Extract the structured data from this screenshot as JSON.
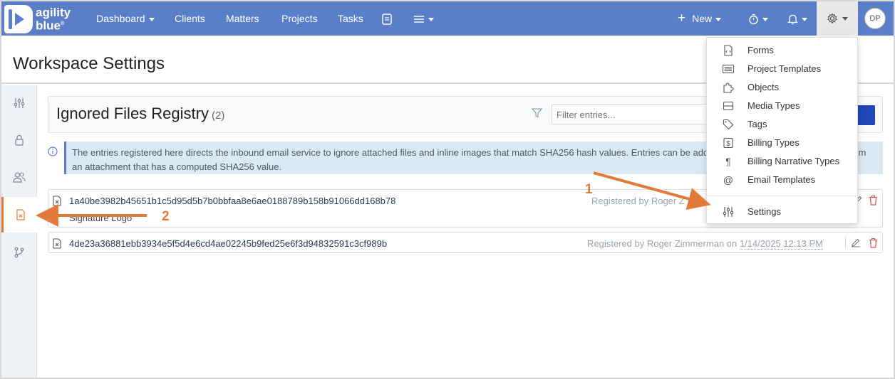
{
  "brand": {
    "line1": "agility",
    "line2": "blue",
    "mark": "®"
  },
  "nav": {
    "dashboard": "Dashboard",
    "clients": "Clients",
    "matters": "Matters",
    "projects": "Projects",
    "tasks": "Tasks",
    "new": "New",
    "avatar": "DP"
  },
  "page": {
    "title": "Workspace Settings"
  },
  "registry": {
    "title": "Ignored Files Registry",
    "count": "(2)",
    "filter_placeholder": "Filter entries...",
    "info": "The entries registered here directs the inbound email service to ignore attached files and inline images that match SHA256 hash values. Entries can be added manually or registered directly from an attachment that has a computed SHA256 value.",
    "entries": [
      {
        "hash": "1a40be3982b45651b1c5d95d5b7b0bbfaa8e6ae0188789b158b91066dd168b78",
        "name": "Signature Logo",
        "registered_prefix": "Registered by Roger Z"
      },
      {
        "hash": "4de23a36881ebb3934e5f5d4e6cd4ae02245b9fed25e6f3d94832591c3cf989b",
        "registered_prefix": "Registered by Roger Zimmerman on",
        "date": "1/14/2025 12:13 PM"
      }
    ]
  },
  "settings_menu": {
    "items": [
      {
        "label": "Forms",
        "icon": "form-file-icon"
      },
      {
        "label": "Project Templates",
        "icon": "list-icon"
      },
      {
        "label": "Objects",
        "icon": "puzzle-icon"
      },
      {
        "label": "Media Types",
        "icon": "media-icon"
      },
      {
        "label": "Tags",
        "icon": "tag-icon"
      },
      {
        "label": "Billing Types",
        "icon": "dollar-icon"
      },
      {
        "label": "Billing Narrative Types",
        "icon": "pilcrow-icon"
      },
      {
        "label": "Email Templates",
        "icon": "at-icon"
      }
    ],
    "settings": {
      "label": "Settings",
      "icon": "sliders-icon"
    }
  },
  "annotations": {
    "step1": "1",
    "step2": "2"
  },
  "colors": {
    "nav": "#5b7ec9",
    "accent": "#e07b39",
    "primary_button": "#1f48b6"
  }
}
